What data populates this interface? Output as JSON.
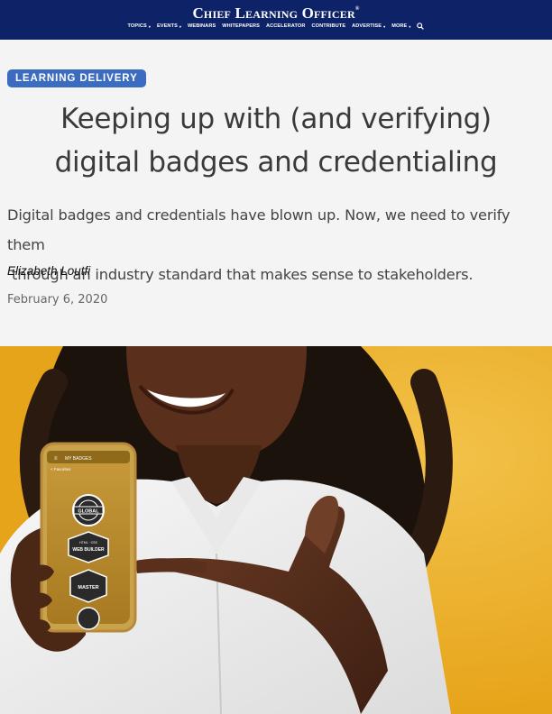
{
  "site": {
    "brand": "Chief Learning Officer",
    "trademark": "®"
  },
  "nav": {
    "items": [
      {
        "label": "TOPICS",
        "dropdown": true
      },
      {
        "label": "EVENTS",
        "dropdown": true
      },
      {
        "label": "WEBINARS",
        "dropdown": false
      },
      {
        "label": "WHITEPAPERS",
        "dropdown": false
      },
      {
        "label": "ACCELERATOR",
        "dropdown": false
      },
      {
        "label": "CONTRIBUTE",
        "dropdown": false
      },
      {
        "label": "ADVERTISE",
        "dropdown": true
      },
      {
        "label": "MORE",
        "dropdown": true
      }
    ],
    "search_icon": "search-icon",
    "caret_glyph": "▾"
  },
  "article": {
    "category": "LEARNING DELIVERY",
    "title_line1": "Keeping up with (and verifying)",
    "title_line2": "digital badges and credentialing",
    "dek_line1": "Digital badges and credentials have blown up. Now, we need to verify them",
    "dek_line2": " through an industry standard that makes sense to stakeholders.",
    "author": "Elizabeth Loutfi",
    "date": "February 6, 2020"
  },
  "hero_phone": {
    "header": "MY BADGES",
    "subheader": "< Favorites",
    "badge1": "GLOBAL",
    "badge2": "WEB BUILDER",
    "badge2_small": "HTML · CSS",
    "badge3": "MASTER"
  },
  "colors": {
    "header_bg": "#0e2367",
    "category_bg": "#3b6cbf",
    "page_bg": "#f4f4f4",
    "hero_bg": "#e9a91d"
  }
}
